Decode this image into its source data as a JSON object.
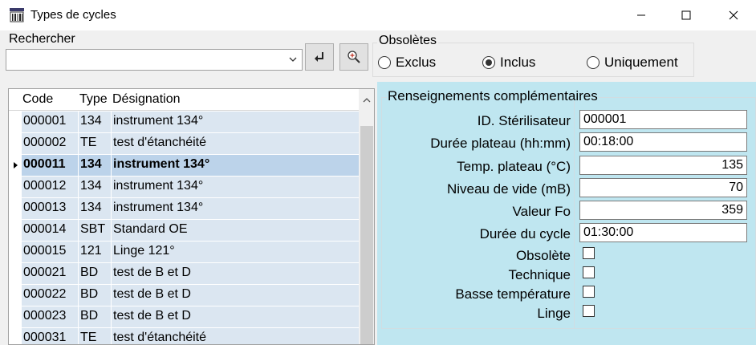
{
  "window": {
    "title": "Types de cycles",
    "icon": "barcode-app-icon"
  },
  "search": {
    "label": "Rechercher",
    "value": "",
    "placeholder": ""
  },
  "toolbar": {
    "enter_icon": "enter-return-icon",
    "zoom_icon": "zoom-in-icon"
  },
  "obsoletes": {
    "label": "Obsolètes",
    "options": [
      {
        "label": "Exclus",
        "selected": false
      },
      {
        "label": "Inclus",
        "selected": true
      },
      {
        "label": "Uniquement",
        "selected": false
      }
    ]
  },
  "grid": {
    "columns": [
      "Code",
      "Type",
      "Désignation"
    ],
    "rows": [
      {
        "code": "000001",
        "type": "134",
        "designation": "instrument 134°",
        "selected": false
      },
      {
        "code": "000002",
        "type": "TE",
        "designation": "test d'étanchéité",
        "selected": false
      },
      {
        "code": "000011",
        "type": "134",
        "designation": "instrument 134°",
        "selected": true
      },
      {
        "code": "000012",
        "type": "134",
        "designation": "instrument 134°",
        "selected": false
      },
      {
        "code": "000013",
        "type": "134",
        "designation": "instrument 134°",
        "selected": false
      },
      {
        "code": "000014",
        "type": "SBT",
        "designation": "Standard OE",
        "selected": false
      },
      {
        "code": "000015",
        "type": "121",
        "designation": "Linge 121°",
        "selected": false
      },
      {
        "code": "000021",
        "type": "BD",
        "designation": "test de B et D",
        "selected": false
      },
      {
        "code": "000022",
        "type": "BD",
        "designation": "test de B et D",
        "selected": false
      },
      {
        "code": "000023",
        "type": "BD",
        "designation": "test de B et D",
        "selected": false
      },
      {
        "code": "000031",
        "type": "TE",
        "designation": "test d'étanchéité",
        "selected": false
      }
    ]
  },
  "details": {
    "title": "Renseignements complémentaires",
    "fields": [
      {
        "label": "ID. Stérilisateur",
        "value": "000001",
        "align": "left"
      },
      {
        "label": "Durée plateau (hh:mm)",
        "value": "00:18:00",
        "align": "left"
      },
      {
        "label": "Temp. plateau (°C)",
        "value": "135",
        "align": "right"
      },
      {
        "label": "Niveau de vide (mB)",
        "value": "70",
        "align": "right"
      },
      {
        "label": "Valeur Fo",
        "value": "359",
        "align": "right"
      },
      {
        "label": "Durée du cycle",
        "value": "01:30:00",
        "align": "left"
      }
    ],
    "checkboxes": [
      {
        "label": "Obsolète",
        "checked": false
      },
      {
        "label": "Technique",
        "checked": false
      },
      {
        "label": "Basse température",
        "checked": false
      },
      {
        "label": "Linge",
        "checked": false
      }
    ]
  },
  "colors": {
    "panel_bg": "#bfe6f0",
    "row_bg": "#dbe6f1",
    "row_selected_bg": "#bcd3ea"
  }
}
